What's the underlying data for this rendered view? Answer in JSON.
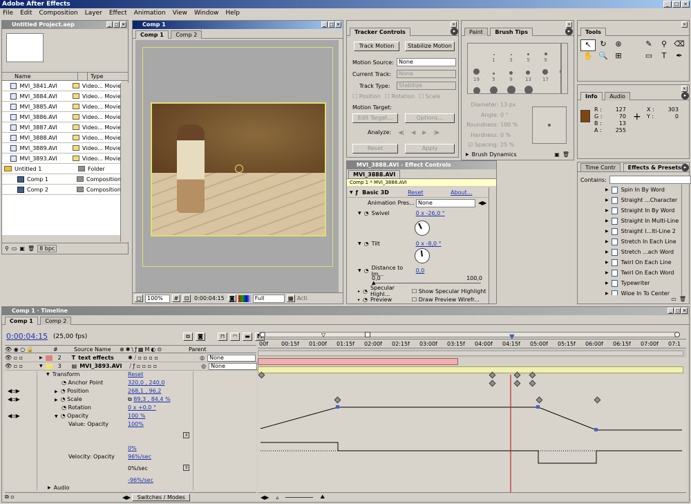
{
  "app": {
    "title": "Adobe After Effects"
  },
  "menu": [
    "File",
    "Edit",
    "Composition",
    "Layer",
    "Effect",
    "Animation",
    "View",
    "Window",
    "Help"
  ],
  "project": {
    "title": "Untitled Project.aep",
    "col_name": "Name",
    "col_type": "Type",
    "items": [
      {
        "name": "MVI_3841.AVI",
        "type": "Video... Movie",
        "kind": "movie",
        "color": "#f0e070"
      },
      {
        "name": "MVI_3884.AVI",
        "type": "Video... Movie",
        "kind": "movie",
        "color": "#f0e070"
      },
      {
        "name": "MVI_3885.AVI",
        "type": "Video... Movie",
        "kind": "movie",
        "color": "#f0e070"
      },
      {
        "name": "MVI_3886.AVI",
        "type": "Video... Movie",
        "kind": "movie",
        "color": "#f0e070"
      },
      {
        "name": "MVI_3887.AVI",
        "type": "Video... Movie",
        "kind": "movie",
        "color": "#f0e070"
      },
      {
        "name": "MVI_3888.AVI",
        "type": "Video... Movie",
        "kind": "movie",
        "color": "#f0e070"
      },
      {
        "name": "MVI_3889.AVI",
        "type": "Video... Movie",
        "kind": "movie",
        "color": "#f0e070"
      },
      {
        "name": "MVI_3893.AVI",
        "type": "Video... Movie",
        "kind": "movie",
        "color": "#f0e070"
      },
      {
        "name": "Untitled 1",
        "type": "Folder",
        "kind": "folder",
        "color": "#909090"
      },
      {
        "name": "Comp 1",
        "type": "Composition",
        "kind": "comp",
        "color": "#909090"
      },
      {
        "name": "Comp 2",
        "type": "Composition",
        "kind": "comp",
        "color": "#909090"
      }
    ],
    "bpc": "8 bpc"
  },
  "comp": {
    "title": "Comp 1",
    "tabs": [
      "Comp 1",
      "Comp 2"
    ],
    "zoom": "100%",
    "timecode": "0:00:04:15",
    "resolution": "Full",
    "active_label": "Acti"
  },
  "tracker": {
    "tab": "Tracker Controls",
    "track_motion": "Track Motion",
    "stabilize_motion": "Stabilize Motion",
    "motion_source_label": "Motion Source:",
    "motion_source": "None",
    "current_track_label": "Current Track:",
    "current_track": "None",
    "track_type_label": "Track Type:",
    "track_type": "Stabilize",
    "position": "Position",
    "rotation": "Rotation",
    "scale": "Scale",
    "motion_target": "Motion Target:",
    "edit_target": "Edit Target...",
    "options": "Options...",
    "analyze": "Analyze:",
    "reset": "Reset",
    "apply": "Apply"
  },
  "brush": {
    "tabs": [
      "Paint",
      "Brush Tips"
    ],
    "sizes": [
      "1",
      "3",
      "5",
      "9",
      "13",
      "19",
      "5",
      "9",
      "13",
      "17",
      "21",
      "27",
      "35",
      "45",
      "65"
    ],
    "diameter_label": "Diameter:",
    "diameter": "13 px",
    "angle_label": "Angle:",
    "angle": "0 °",
    "roundness_label": "Roundness:",
    "roundness": "100 %",
    "hardness_label": "Hardness:",
    "hardness": "0 %",
    "spacing_label": "Spacing:",
    "spacing": "25 %",
    "dynamics": "Brush Dynamics"
  },
  "tools": {
    "title": "Tools"
  },
  "info": {
    "tabs": [
      "Info",
      "Audio"
    ],
    "r": "127",
    "g": "70",
    "b": "13",
    "a": "255",
    "x": "303",
    "y": "0",
    "swatch": "#7f460d"
  },
  "effects_presets": {
    "tabs": [
      "Time Contr",
      "Effects & Presets"
    ],
    "contains_label": "Contains:",
    "items": [
      "Spin In By Word",
      "Straight ...Character",
      "Straight In By Word",
      "Straight In Multi-Line",
      "Straight I...lti-Line 2",
      "Stretch In Each Line",
      "Stretch ...ach Word",
      "Twirl On Each Line",
      "Twirl On Each Word",
      "Typewriter",
      "Wipe In To Center"
    ]
  },
  "effect_controls": {
    "title": "MVI_3888.AVI - Effect Controls",
    "tab": "MVI_3888.AVI",
    "breadcrumb": "Comp 1 * MVI_3888.AVI",
    "effect_name": "Basic 3D",
    "reset": "Reset",
    "about": "About...",
    "animation_presets_label": "Animation Pres...",
    "animation_presets": "None",
    "swivel_label": "Swivel",
    "swivel": "0 x -26,0 °",
    "tilt_label": "Tilt",
    "tilt": "0 x -8,0 °",
    "distance_label": "Distance to Im...",
    "distance": "0,0",
    "slider_min": "0,0",
    "slider_max": "100,0",
    "specular_label": "Specular Highl...",
    "specular_check": "Show Specular Highlight",
    "preview_label": "Preview",
    "preview_check": "Draw Preview Wirefr..."
  },
  "timeline": {
    "title": "Comp 1 · Timeline",
    "tabs": [
      "Comp 1",
      "Comp 2"
    ],
    "timecode": "0:00:04:15",
    "fps": "(25,00 fps)",
    "col_num": "#",
    "col_source": "Source Name",
    "col_parent": "Parent",
    "layers": [
      {
        "num": "2",
        "name": "text effects",
        "parent": "None",
        "color": "#e08080"
      },
      {
        "num": "3",
        "name": "MVI_3893.AVI",
        "parent": "None",
        "color": "#f0e070"
      }
    ],
    "transform": "Transform",
    "transform_reset": "Reset",
    "anchor_label": "Anchor Point",
    "anchor": "320,0 , 240,0",
    "position_label": "Position",
    "position": "268,1 , 96,2",
    "scale_label": "Scale",
    "scale": "89,3 , 84,4 %",
    "rotation_label": "Rotation",
    "rotation": "0 x +0,0 °",
    "opacity_label": "Opacity",
    "opacity": "100 %",
    "value_opacity_label": "Value: Opacity",
    "value_opacity": "100%",
    "value_zero": "0%",
    "velocity_label": "Velocity: Opacity",
    "velocity_top": "96%/sec",
    "velocity_mid": "0%/sec",
    "velocity_bottom": "-96%/sec",
    "audio_label": "Audio",
    "switches": "Switches / Modes",
    "ruler": [
      "00f",
      "00:15f",
      "01:00f",
      "01:15f",
      "02:00f",
      "02:15f",
      "03:00f",
      "03:15f",
      "04:00f",
      "04:15f",
      "05:00f",
      "05:15f",
      "06:00f",
      "06:15f",
      "07:00f",
      "07:1"
    ]
  }
}
